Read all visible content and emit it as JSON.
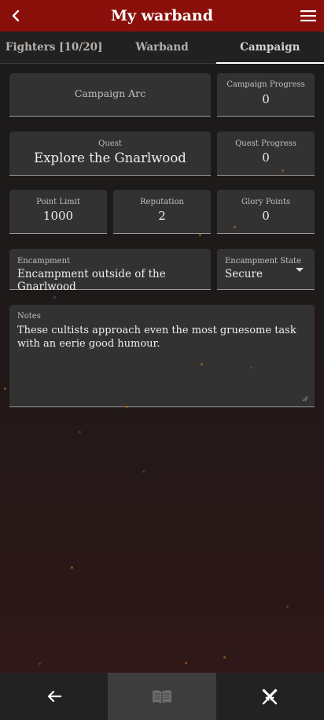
{
  "header": {
    "title": "My warband",
    "back_icon": "chevron-left-icon",
    "menu_icon": "hamburger-menu-icon"
  },
  "tabs": [
    {
      "label": "Fighters [10/20]",
      "active": false
    },
    {
      "label": "Warband",
      "active": false
    },
    {
      "label": "Campaign",
      "active": true
    }
  ],
  "campaign": {
    "arc": {
      "label": "Campaign Arc"
    },
    "progress": {
      "label": "Campaign Progress",
      "value": "0"
    },
    "quest": {
      "label": "Quest",
      "value": "Explore the Gnarlwood"
    },
    "quest_progress": {
      "label": "Quest Progress",
      "value": "0"
    },
    "point_limit": {
      "label": "Point Limit",
      "value": "1000"
    },
    "reputation": {
      "label": "Reputation",
      "value": "2"
    },
    "glory_points": {
      "label": "Glory Points",
      "value": "0"
    },
    "encampment": {
      "label": "Encampment",
      "value": "Encampment outside of the Gnarlwood"
    },
    "encampment_state": {
      "label": "Encampment State",
      "value": "Secure"
    },
    "notes": {
      "label": "Notes",
      "value": "These cultists approach even the most gruesome task with an eerie good humour."
    }
  },
  "bottom_nav": [
    {
      "icon": "arrow-left-icon",
      "active": false
    },
    {
      "icon": "open-book-icon",
      "active": true
    },
    {
      "icon": "crossed-swords-icon",
      "active": false
    }
  ],
  "colors": {
    "header_bg": "#8a0f0a",
    "field_bg": "#333232",
    "spark": "#a8641f"
  }
}
